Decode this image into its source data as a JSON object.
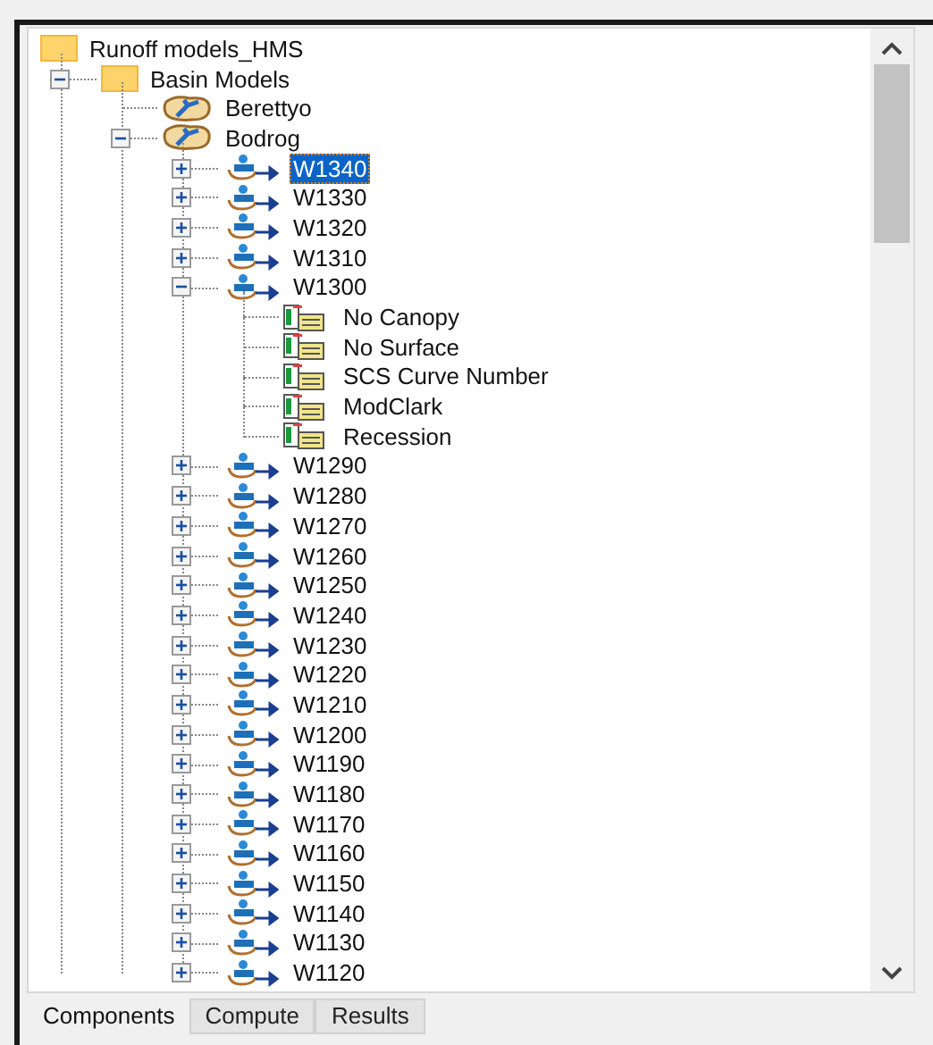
{
  "tree": {
    "label": "Runoff models_HMS",
    "kind": "folder",
    "selected": false,
    "children": [
      {
        "label": "Basin Models",
        "kind": "folder",
        "selected": false,
        "expanded": true,
        "children": [
          {
            "label": "Berettyo",
            "kind": "basin",
            "selected": false
          },
          {
            "label": "Bodrog",
            "kind": "basin",
            "selected": false,
            "expanded": true,
            "children": [
              {
                "label": "W1340",
                "kind": "subbasin",
                "selected": true,
                "expanded": false
              },
              {
                "label": "W1330",
                "kind": "subbasin",
                "selected": false,
                "expanded": false
              },
              {
                "label": "W1320",
                "kind": "subbasin",
                "selected": false,
                "expanded": false
              },
              {
                "label": "W1310",
                "kind": "subbasin",
                "selected": false,
                "expanded": false
              },
              {
                "label": "W1300",
                "kind": "subbasin",
                "selected": false,
                "expanded": true,
                "children": [
                  {
                    "label": "No Canopy",
                    "kind": "method",
                    "selected": false
                  },
                  {
                    "label": "No Surface",
                    "kind": "method",
                    "selected": false
                  },
                  {
                    "label": "SCS Curve Number",
                    "kind": "method",
                    "selected": false
                  },
                  {
                    "label": "ModClark",
                    "kind": "method",
                    "selected": false
                  },
                  {
                    "label": "Recession",
                    "kind": "method",
                    "selected": false
                  }
                ]
              },
              {
                "label": "W1290",
                "kind": "subbasin",
                "selected": false,
                "expanded": false
              },
              {
                "label": "W1280",
                "kind": "subbasin",
                "selected": false,
                "expanded": false
              },
              {
                "label": "W1270",
                "kind": "subbasin",
                "selected": false,
                "expanded": false
              },
              {
                "label": "W1260",
                "kind": "subbasin",
                "selected": false,
                "expanded": false
              },
              {
                "label": "W1250",
                "kind": "subbasin",
                "selected": false,
                "expanded": false
              },
              {
                "label": "W1240",
                "kind": "subbasin",
                "selected": false,
                "expanded": false
              },
              {
                "label": "W1230",
                "kind": "subbasin",
                "selected": false,
                "expanded": false
              },
              {
                "label": "W1220",
                "kind": "subbasin",
                "selected": false,
                "expanded": false
              },
              {
                "label": "W1210",
                "kind": "subbasin",
                "selected": false,
                "expanded": false
              },
              {
                "label": "W1200",
                "kind": "subbasin",
                "selected": false,
                "expanded": false
              },
              {
                "label": "W1190",
                "kind": "subbasin",
                "selected": false,
                "expanded": false
              },
              {
                "label": "W1180",
                "kind": "subbasin",
                "selected": false,
                "expanded": false
              },
              {
                "label": "W1170",
                "kind": "subbasin",
                "selected": false,
                "expanded": false
              },
              {
                "label": "W1160",
                "kind": "subbasin",
                "selected": false,
                "expanded": false
              },
              {
                "label": "W1150",
                "kind": "subbasin",
                "selected": false,
                "expanded": false
              },
              {
                "label": "W1140",
                "kind": "subbasin",
                "selected": false,
                "expanded": false
              },
              {
                "label": "W1130",
                "kind": "subbasin",
                "selected": false,
                "expanded": false
              },
              {
                "label": "W1120",
                "kind": "subbasin",
                "selected": false,
                "expanded": false
              }
            ]
          }
        ]
      }
    ]
  },
  "tabs": [
    {
      "label": "Components",
      "selected": true
    },
    {
      "label": "Compute",
      "selected": false
    },
    {
      "label": "Results",
      "selected": false
    }
  ]
}
